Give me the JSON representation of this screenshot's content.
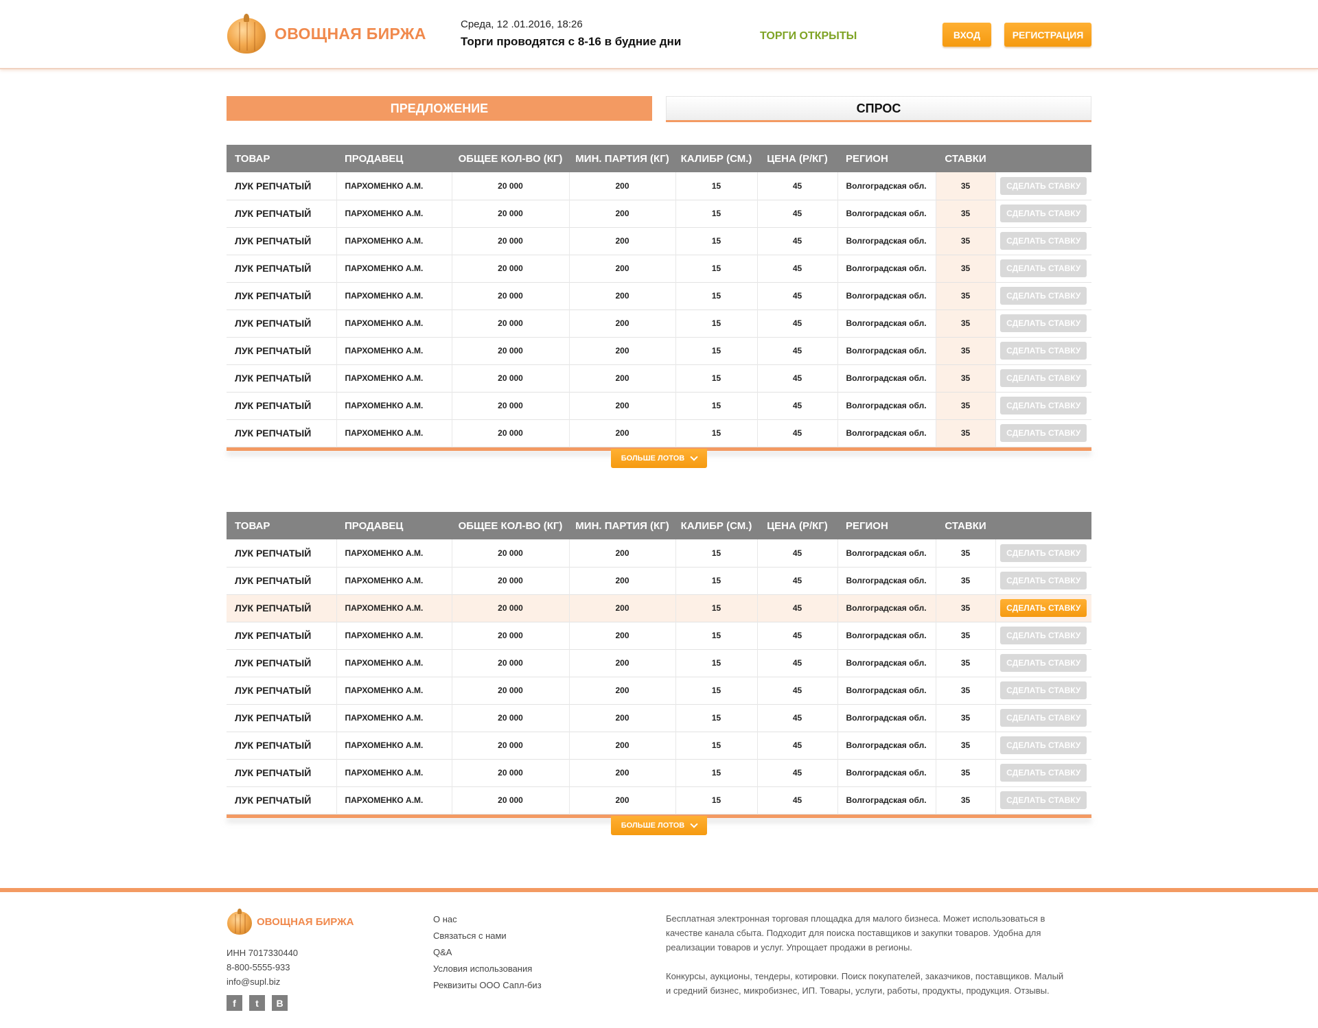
{
  "header": {
    "logo_text": "ОВОЩНАЯ БИРЖА",
    "date": "Среда, 12 .01.2016, 18:26",
    "schedule": "Торги проводятся с 8-16 в будние дни",
    "trade_status": "ТОРГИ ОТКРЫТЫ",
    "login_label": "ВХОД",
    "register_label": "РЕГИСТРАЦИЯ"
  },
  "tabs": {
    "offer": "ПРЕДЛОЖЕНИЕ",
    "demand": "СПРОС",
    "active": "offer"
  },
  "columns": [
    "ТОВАР",
    "ПРОДАВЕЦ",
    "ОБЩЕЕ КОЛ-ВО (КГ)",
    "МИН. ПАРТИЯ (КГ)",
    "КАЛИБР (СМ.)",
    "ЦЕНА (Р/КГ)",
    "РЕГИОН",
    "СТАВКИ"
  ],
  "row_template": {
    "product": "ЛУК РЕПЧАТЫЙ",
    "seller": "ПАРХОМЕНКО А.М.",
    "total": "20 000",
    "min_batch": "200",
    "caliber": "15",
    "price": "45",
    "region": "Волгоградская обл.",
    "bids": "35",
    "action": "СДЕЛАТЬ СТАВКУ"
  },
  "more_label": "БОЛЬШЕ ЛОТОВ",
  "tables": [
    {
      "rows": 10,
      "highlight_row": -1
    },
    {
      "rows": 10,
      "highlight_row": 2
    }
  ],
  "footer": {
    "logo_text": "ОВОЩНАЯ БИРЖА",
    "inn": "ИНН 7017330440",
    "phone": "8-800-5555-933",
    "email": "info@supl.biz",
    "social": [
      {
        "icon": "facebook-icon",
        "glyph": "f"
      },
      {
        "icon": "twitter-icon",
        "glyph": "t"
      },
      {
        "icon": "vk-icon",
        "glyph": "B"
      }
    ],
    "links": [
      "О нас",
      "Связаться с нами",
      "Q&A",
      "Условия использования",
      "Реквизиты ООО Сапл-биз"
    ],
    "about_1": "Бесплатная электронная торговая площадка для малого бизнеса. Может использоваться в качестве канала сбыта. Подходит для поиска поставщиков и закупки товаров. Удобна для реализации товаров и услуг. Упрощает продажи в регионы.",
    "about_2": "Конкурсы, аукционы, тендеры, котировки. Поиск покупателей, заказчиков, поставщиков. Малый и средний бизнес, микробизнес, ИП. Товары, услуги, работы, продукты, продукция. Отзывы."
  },
  "colors": {
    "accent": "#f39a62",
    "button": "#f59a10",
    "status_green": "#7ea324",
    "header_gray": "#838383"
  }
}
